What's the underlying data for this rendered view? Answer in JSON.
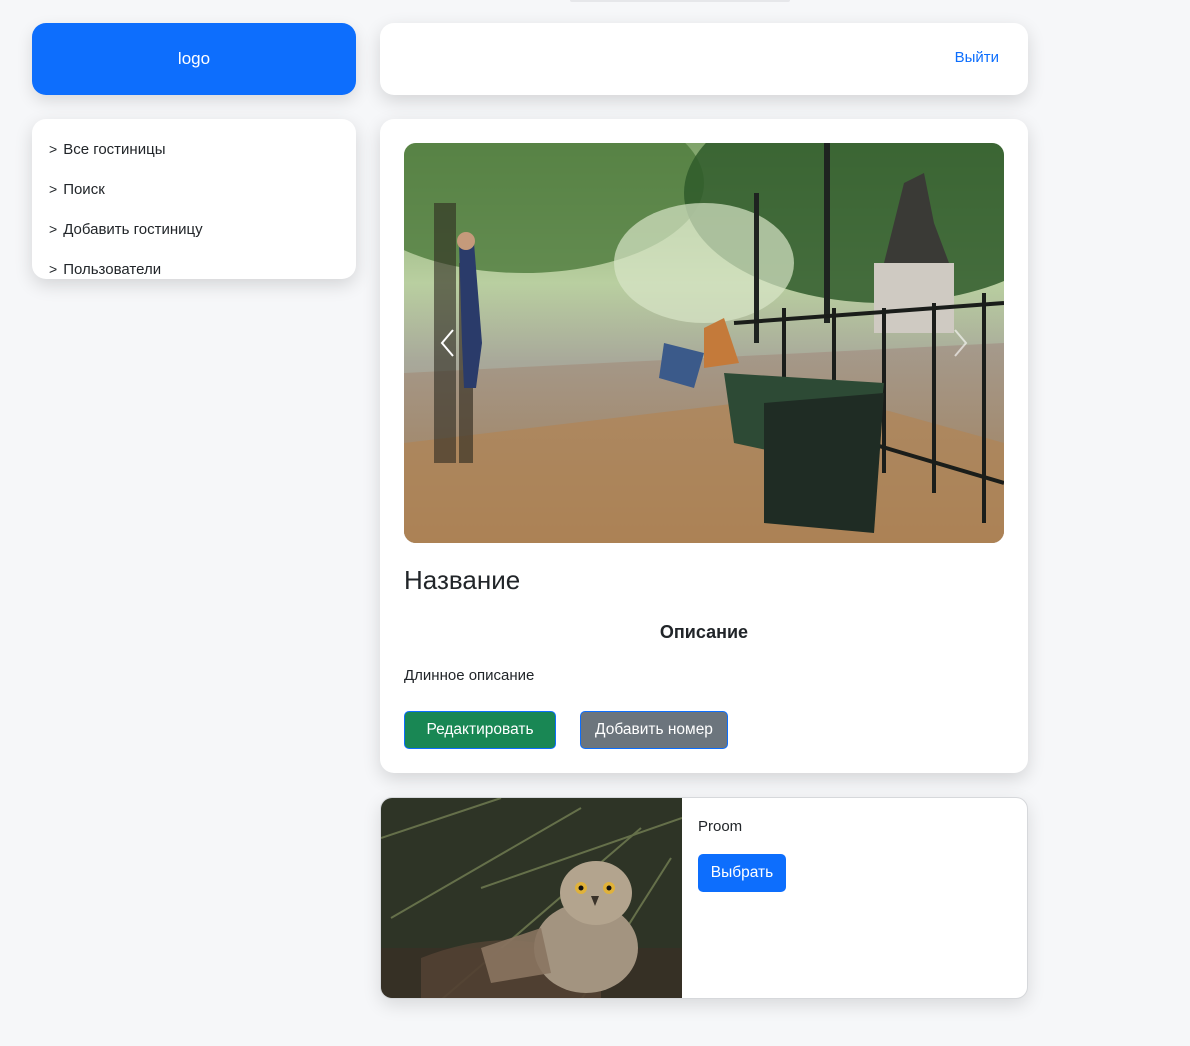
{
  "logo": {
    "text": "logo"
  },
  "sidebar": {
    "items": [
      {
        "chevron": ">",
        "label": "Все гостиницы"
      },
      {
        "chevron": ">",
        "label": "Поиск"
      },
      {
        "chevron": ">",
        "label": "Добавить гостиницу"
      },
      {
        "chevron": ">",
        "label": "Пользователи"
      }
    ]
  },
  "header": {
    "logout_label": "Выйти"
  },
  "hotel": {
    "title": "Название",
    "description_heading": "Описание",
    "long_description": "Длинное описание",
    "edit_button": "Редактировать",
    "add_room_button": "Добавить номер"
  },
  "room": {
    "name": "Proom",
    "select_button": "Выбрать"
  },
  "colors": {
    "primary": "#0d6efd",
    "success": "#198754",
    "secondary": "#6c757d",
    "background": "#f6f7f9"
  },
  "icons": {
    "carousel_prev": "chevron-left-icon",
    "carousel_next": "chevron-right-icon"
  }
}
